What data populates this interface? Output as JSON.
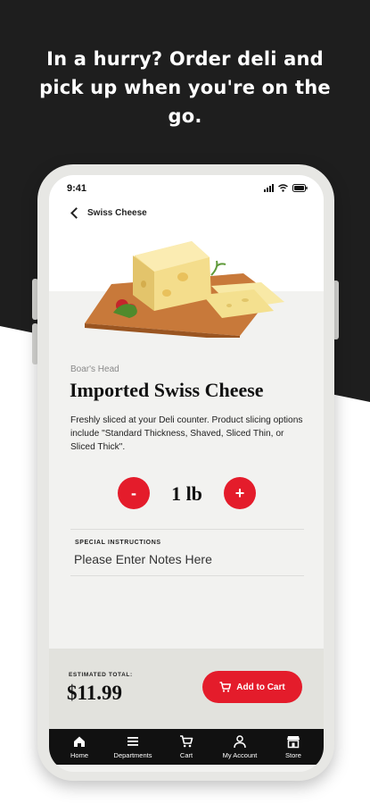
{
  "promo": {
    "headline": "In a hurry? Order deli and pick up when you're on the go."
  },
  "status_bar": {
    "time": "9:41"
  },
  "header": {
    "title": "Swiss Cheese"
  },
  "product": {
    "brand": "Boar's Head",
    "name": "Imported Swiss Cheese",
    "description": "Freshly sliced at your Deli counter. Product slicing options include \"Standard Thickness, Shaved, Sliced Thin, or Sliced Thick\"."
  },
  "quantity": {
    "minus_label": "-",
    "plus_label": "+",
    "value": "1 lb"
  },
  "instructions": {
    "label": "SPECIAL INSTRUCTIONS",
    "placeholder": "Please Enter Notes Here"
  },
  "summary": {
    "estimated_label": "ESTIMATED TOTAL:",
    "total": "$11.99",
    "add_to_cart_label": "Add to Cart"
  },
  "tabs": [
    {
      "label": "Home",
      "icon": "home-icon"
    },
    {
      "label": "Departments",
      "icon": "menu-icon"
    },
    {
      "label": "Cart",
      "icon": "cart-icon"
    },
    {
      "label": "My Account",
      "icon": "user-icon"
    },
    {
      "label": "Store",
      "icon": "store-icon"
    }
  ],
  "colors": {
    "accent": "#e41c2b",
    "background_dark": "#1e1e1e",
    "tab_bar": "#111111"
  }
}
